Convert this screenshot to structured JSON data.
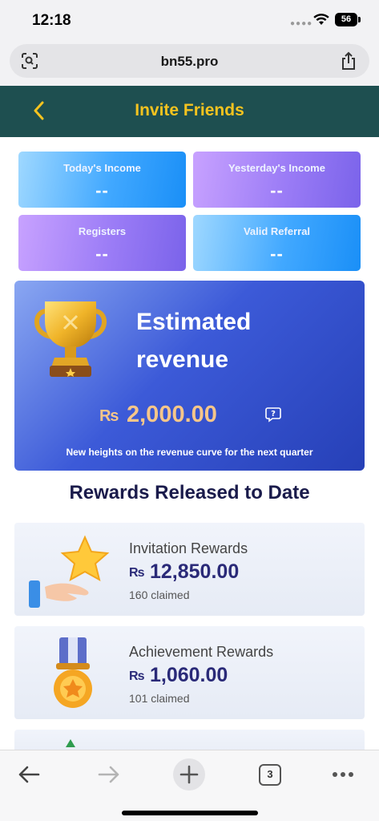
{
  "status_bar": {
    "time": "12:18",
    "battery": "56"
  },
  "browser": {
    "url": "bn55.pro",
    "tab_count": "3"
  },
  "header": {
    "title": "Invite Friends"
  },
  "stats": [
    {
      "label": "Today's Income",
      "value": "--"
    },
    {
      "label": "Yesterday's Income",
      "value": "--"
    },
    {
      "label": "Registers",
      "value": "--"
    },
    {
      "label": "Valid Referral",
      "value": "--"
    }
  ],
  "revenue": {
    "title": "Estimated revenue",
    "currency": "₨",
    "amount": "2,000.00",
    "note": "New heights on the revenue curve for the next quarter"
  },
  "rewards_section": {
    "title": "Rewards Released to Date"
  },
  "rewards": [
    {
      "label": "Invitation Rewards",
      "currency": "₨",
      "amount": "12,850.00",
      "claimed": "160 claimed",
      "icon": "star-hand-icon"
    },
    {
      "label": "Achievement Rewards",
      "currency": "₨",
      "amount": "1,060.00",
      "claimed": "101 claimed",
      "icon": "medal-icon"
    }
  ],
  "colors": {
    "header_bg": "#1e4f50",
    "header_title": "#f5c31f",
    "amount_gold": "#f6c68a",
    "reward_amount": "#2a2a78"
  }
}
